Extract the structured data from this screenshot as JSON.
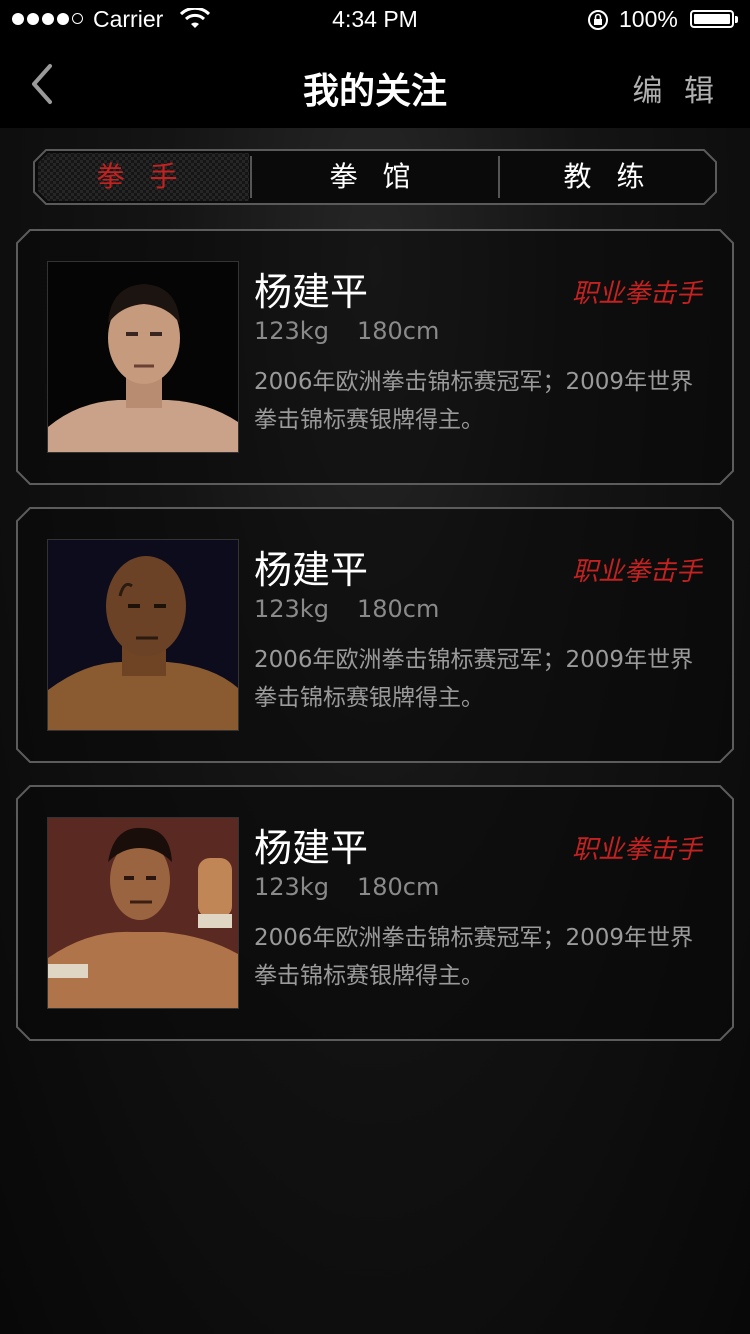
{
  "status_bar": {
    "carrier": "Carrier",
    "time": "4:34 PM",
    "battery": "100%"
  },
  "nav": {
    "title": "我的关注",
    "edit": "编 辑"
  },
  "tabs": [
    {
      "label": "拳 手",
      "active": true
    },
    {
      "label": "拳 馆",
      "active": false
    },
    {
      "label": "教 练",
      "active": false
    }
  ],
  "cards": [
    {
      "name": "杨建平",
      "role": "职业拳击手",
      "weight": "123kg",
      "height": "180cm",
      "desc": "2006年欧洲拳击锦标赛冠军；2009年世界拳击锦标赛银牌得主。"
    },
    {
      "name": "杨建平",
      "role": "职业拳击手",
      "weight": "123kg",
      "height": "180cm",
      "desc": "2006年欧洲拳击锦标赛冠军；2009年世界拳击锦标赛银牌得主。"
    },
    {
      "name": "杨建平",
      "role": "职业拳击手",
      "weight": "123kg",
      "height": "180cm",
      "desc": "2006年欧洲拳击锦标赛冠军；2009年世界拳击锦标赛银牌得主。"
    }
  ],
  "colors": {
    "accent": "#c42121",
    "background": "#0c0c0c"
  }
}
